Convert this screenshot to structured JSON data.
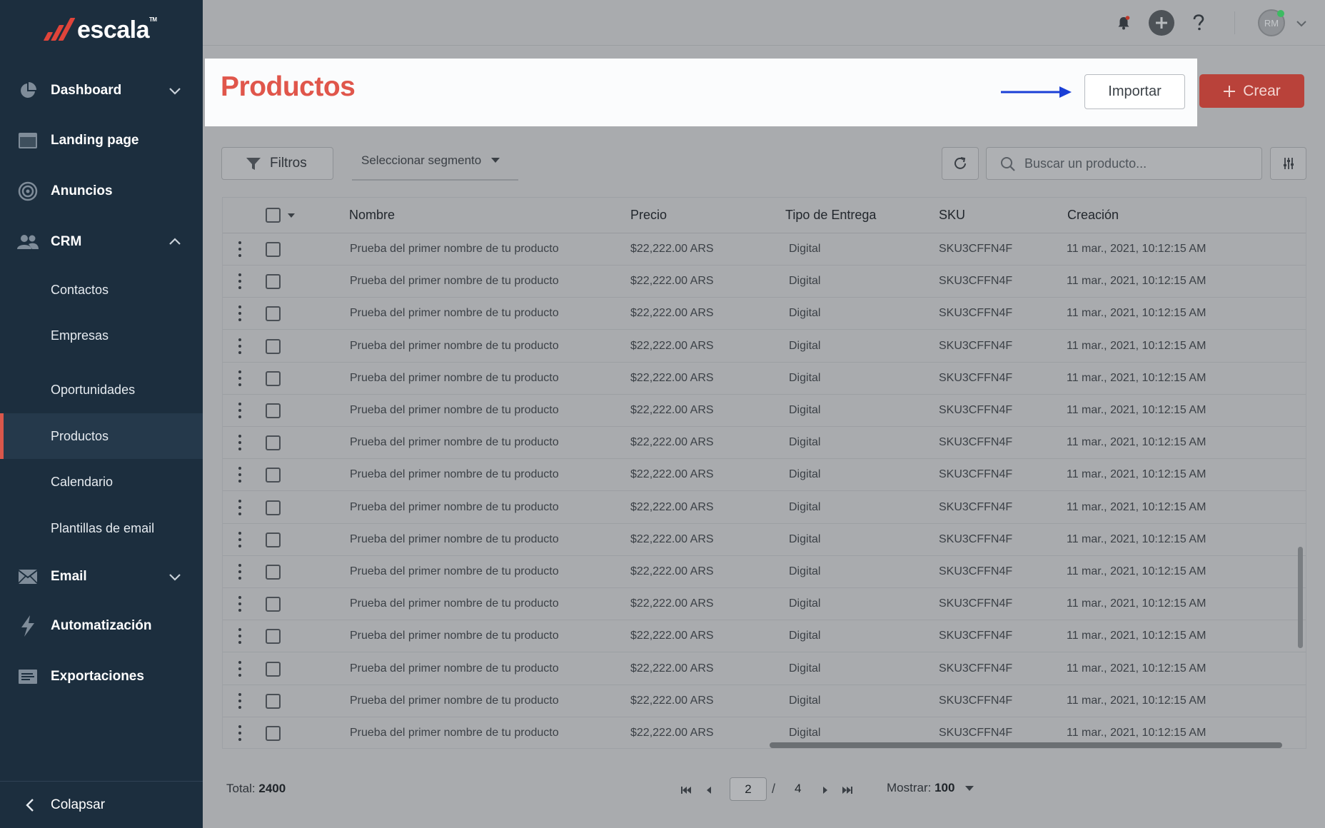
{
  "brand": {
    "name": "escala",
    "mark": "TM",
    "accent_color": "#e0443a"
  },
  "sidebar": {
    "items": [
      {
        "label": "Dashboard",
        "icon": "pie-chart-icon",
        "expandable": true,
        "expanded": false
      },
      {
        "label": "Landing page",
        "icon": "browser-window-icon"
      },
      {
        "label": "Anuncios",
        "icon": "target-icon"
      },
      {
        "label": "CRM",
        "icon": "users-icon",
        "expandable": true,
        "expanded": true
      },
      {
        "label": "Email",
        "icon": "envelope-icon",
        "expandable": true,
        "expanded": false
      },
      {
        "label": "Automatización",
        "icon": "lightning-icon"
      },
      {
        "label": "Exportaciones",
        "icon": "document-list-icon"
      }
    ],
    "crm_subitems": [
      {
        "label": "Contactos"
      },
      {
        "label": "Empresas"
      },
      {
        "label": "Oportunidades"
      },
      {
        "label": "Productos",
        "active": true
      },
      {
        "label": "Calendario"
      },
      {
        "label": "Plantillas de email"
      }
    ],
    "collapse_label": "Colapsar"
  },
  "topbar": {
    "icons": [
      "bell-icon",
      "plus-circle-icon",
      "help-icon"
    ],
    "user": {
      "initials": "RM",
      "online": true
    }
  },
  "header": {
    "title": "Productos",
    "title_color": "#e0564b",
    "import_label": "Importar",
    "create_label": "Crear",
    "create_color": "#b9423a",
    "arrow_color": "#1a3fd6"
  },
  "toolbar": {
    "filters_label": "Filtros",
    "segment_label": "Seleccionar segmento",
    "search_placeholder": "Buscar un producto..."
  },
  "table": {
    "columns": [
      "Nombre",
      "Precio",
      "Tipo de Entrega",
      "SKU",
      "Creación"
    ],
    "rows": [
      {
        "name": "Prueba del primer nombre de tu producto",
        "price": "$22,222.00 ARS",
        "delivery": "Digital",
        "sku": "SKU3CFFN4F",
        "created": "11 mar., 2021, 10:12:15 AM"
      },
      {
        "name": "Prueba del primer nombre de tu producto",
        "price": "$22,222.00 ARS",
        "delivery": "Digital",
        "sku": "SKU3CFFN4F",
        "created": "11 mar., 2021, 10:12:15 AM"
      },
      {
        "name": "Prueba del primer nombre de tu producto",
        "price": "$22,222.00 ARS",
        "delivery": "Digital",
        "sku": "SKU3CFFN4F",
        "created": "11 mar., 2021, 10:12:15 AM"
      },
      {
        "name": "Prueba del primer nombre de tu producto",
        "price": "$22,222.00 ARS",
        "delivery": "Digital",
        "sku": "SKU3CFFN4F",
        "created": "11 mar., 2021, 10:12:15 AM"
      },
      {
        "name": "Prueba del primer nombre de tu producto",
        "price": "$22,222.00 ARS",
        "delivery": "Digital",
        "sku": "SKU3CFFN4F",
        "created": "11 mar., 2021, 10:12:15 AM"
      },
      {
        "name": "Prueba del primer nombre de tu producto",
        "price": "$22,222.00 ARS",
        "delivery": "Digital",
        "sku": "SKU3CFFN4F",
        "created": "11 mar., 2021, 10:12:15 AM"
      },
      {
        "name": "Prueba del primer nombre de tu producto",
        "price": "$22,222.00 ARS",
        "delivery": "Digital",
        "sku": "SKU3CFFN4F",
        "created": "11 mar., 2021, 10:12:15 AM"
      },
      {
        "name": "Prueba del primer nombre de tu producto",
        "price": "$22,222.00 ARS",
        "delivery": "Digital",
        "sku": "SKU3CFFN4F",
        "created": "11 mar., 2021, 10:12:15 AM"
      },
      {
        "name": "Prueba del primer nombre de tu producto",
        "price": "$22,222.00 ARS",
        "delivery": "Digital",
        "sku": "SKU3CFFN4F",
        "created": "11 mar., 2021, 10:12:15 AM"
      },
      {
        "name": "Prueba del primer nombre de tu producto",
        "price": "$22,222.00 ARS",
        "delivery": "Digital",
        "sku": "SKU3CFFN4F",
        "created": "11 mar., 2021, 10:12:15 AM"
      },
      {
        "name": "Prueba del primer nombre de tu producto",
        "price": "$22,222.00 ARS",
        "delivery": "Digital",
        "sku": "SKU3CFFN4F",
        "created": "11 mar., 2021, 10:12:15 AM"
      },
      {
        "name": "Prueba del primer nombre de tu producto",
        "price": "$22,222.00 ARS",
        "delivery": "Digital",
        "sku": "SKU3CFFN4F",
        "created": "11 mar., 2021, 10:12:15 AM"
      },
      {
        "name": "Prueba del primer nombre de tu producto",
        "price": "$22,222.00 ARS",
        "delivery": "Digital",
        "sku": "SKU3CFFN4F",
        "created": "11 mar., 2021, 10:12:15 AM"
      },
      {
        "name": "Prueba del primer nombre de tu producto",
        "price": "$22,222.00 ARS",
        "delivery": "Digital",
        "sku": "SKU3CFFN4F",
        "created": "11 mar., 2021, 10:12:15 AM"
      },
      {
        "name": "Prueba del primer nombre de tu producto",
        "price": "$22,222.00 ARS",
        "delivery": "Digital",
        "sku": "SKU3CFFN4F",
        "created": "11 mar., 2021, 10:12:15 AM"
      },
      {
        "name": "Prueba del primer nombre de tu producto",
        "price": "$22,222.00 ARS",
        "delivery": "Digital",
        "sku": "SKU3CFFN4F",
        "created": "11 mar., 2021, 10:12:15 AM"
      }
    ]
  },
  "footer": {
    "total_label": "Total:",
    "total_value": "2400",
    "current_page": "2",
    "page_separator": "/",
    "total_pages": "4",
    "show_label": "Mostrar:",
    "show_value": "100"
  }
}
